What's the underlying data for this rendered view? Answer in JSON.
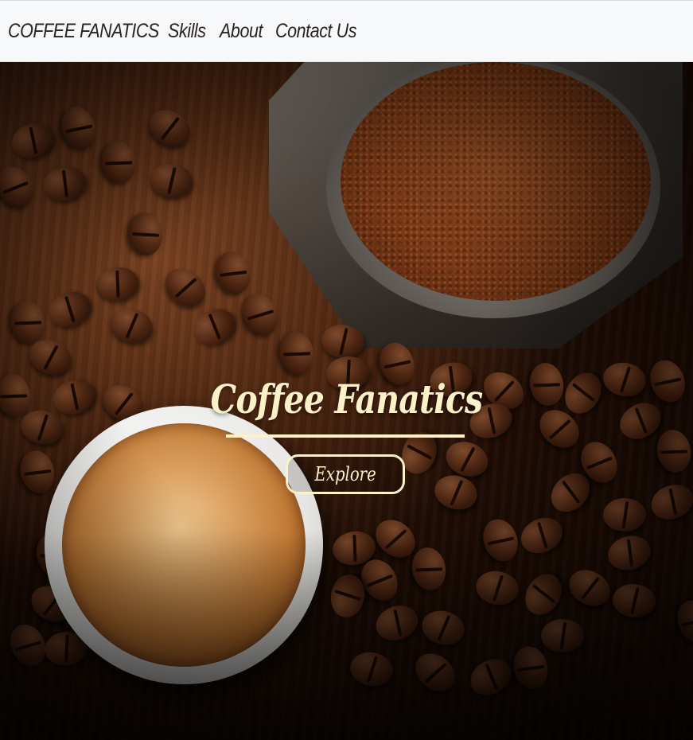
{
  "navbar": {
    "brand": "COFFEE FANATICS",
    "links": [
      {
        "label": "Skills"
      },
      {
        "label": "About"
      },
      {
        "label": "Contact Us"
      }
    ]
  },
  "hero": {
    "title": "Coffee Fanatics",
    "button_label": "Explore"
  },
  "colors": {
    "navbar_bg": "#f7f8fa",
    "nav_text": "#2a2220",
    "hero_text": "#fdf1c8"
  }
}
